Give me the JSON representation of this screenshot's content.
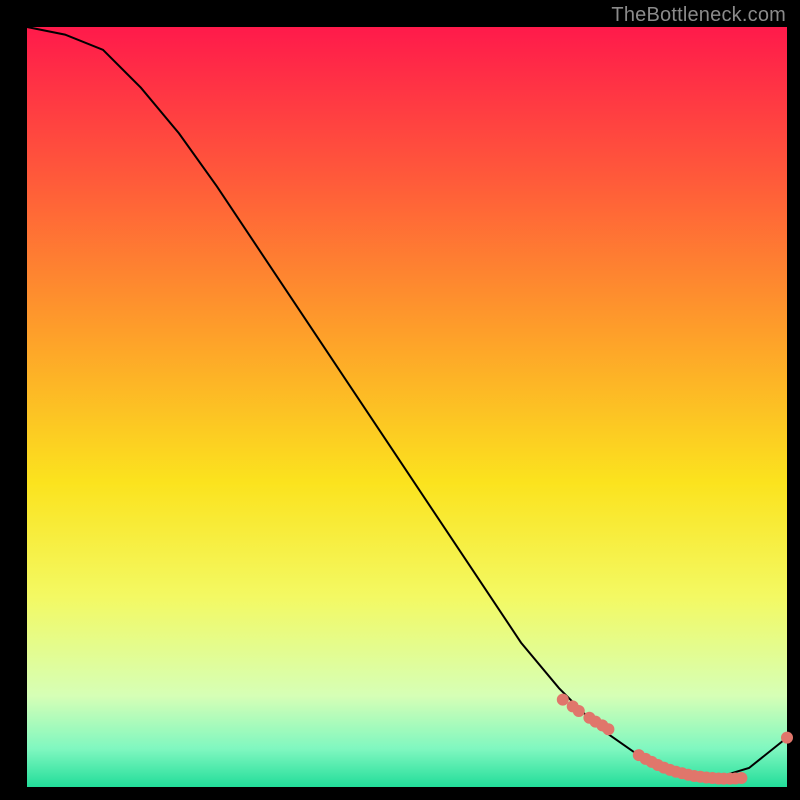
{
  "watermark": "TheBottleneck.com",
  "chart_data": {
    "type": "line",
    "title": "",
    "xlabel": "",
    "ylabel": "",
    "xlim": [
      0,
      100
    ],
    "ylim": [
      0,
      100
    ],
    "grid": false,
    "legend": false,
    "background_gradient": {
      "direction": "vertical",
      "stops": [
        {
          "t": 0.0,
          "color": "#ff1a4b"
        },
        {
          "t": 0.2,
          "color": "#ff5a3a"
        },
        {
          "t": 0.4,
          "color": "#fe9e2a"
        },
        {
          "t": 0.6,
          "color": "#fbe31e"
        },
        {
          "t": 0.75,
          "color": "#f3f963"
        },
        {
          "t": 0.88,
          "color": "#d6ffb6"
        },
        {
          "t": 0.95,
          "color": "#7ff7c0"
        },
        {
          "t": 1.0,
          "color": "#22dd9a"
        }
      ]
    },
    "series": [
      {
        "name": "curve",
        "type": "line",
        "color": "#000000",
        "x": [
          0,
          5,
          10,
          15,
          20,
          25,
          30,
          35,
          40,
          45,
          50,
          55,
          60,
          65,
          70,
          72,
          75,
          80,
          85,
          90,
          95,
          100
        ],
        "y": [
          100,
          99,
          97,
          92,
          86,
          79,
          71.5,
          64,
          56.5,
          49,
          41.5,
          34,
          26.5,
          19,
          13,
          11,
          8,
          4.5,
          2.2,
          1.0,
          2.5,
          6.5
        ]
      },
      {
        "name": "lower-scatter",
        "type": "scatter",
        "color": "#e0766b",
        "radius": 6,
        "x": [
          70.5,
          71.8,
          72.6,
          74.0,
          74.8,
          75.7,
          76.5,
          80.5,
          81.4,
          82.2,
          83.0,
          83.8,
          84.6,
          85.4,
          86.2,
          87.0,
          87.8,
          88.6,
          89.4,
          90.2,
          91.0,
          91.7,
          92.5,
          93.2,
          94.0,
          100.0
        ],
        "y": [
          11.5,
          10.6,
          10.0,
          9.1,
          8.6,
          8.1,
          7.6,
          4.2,
          3.7,
          3.3,
          2.9,
          2.55,
          2.25,
          2.0,
          1.8,
          1.6,
          1.45,
          1.35,
          1.25,
          1.18,
          1.12,
          1.1,
          1.1,
          1.12,
          1.18,
          6.5
        ]
      }
    ]
  }
}
